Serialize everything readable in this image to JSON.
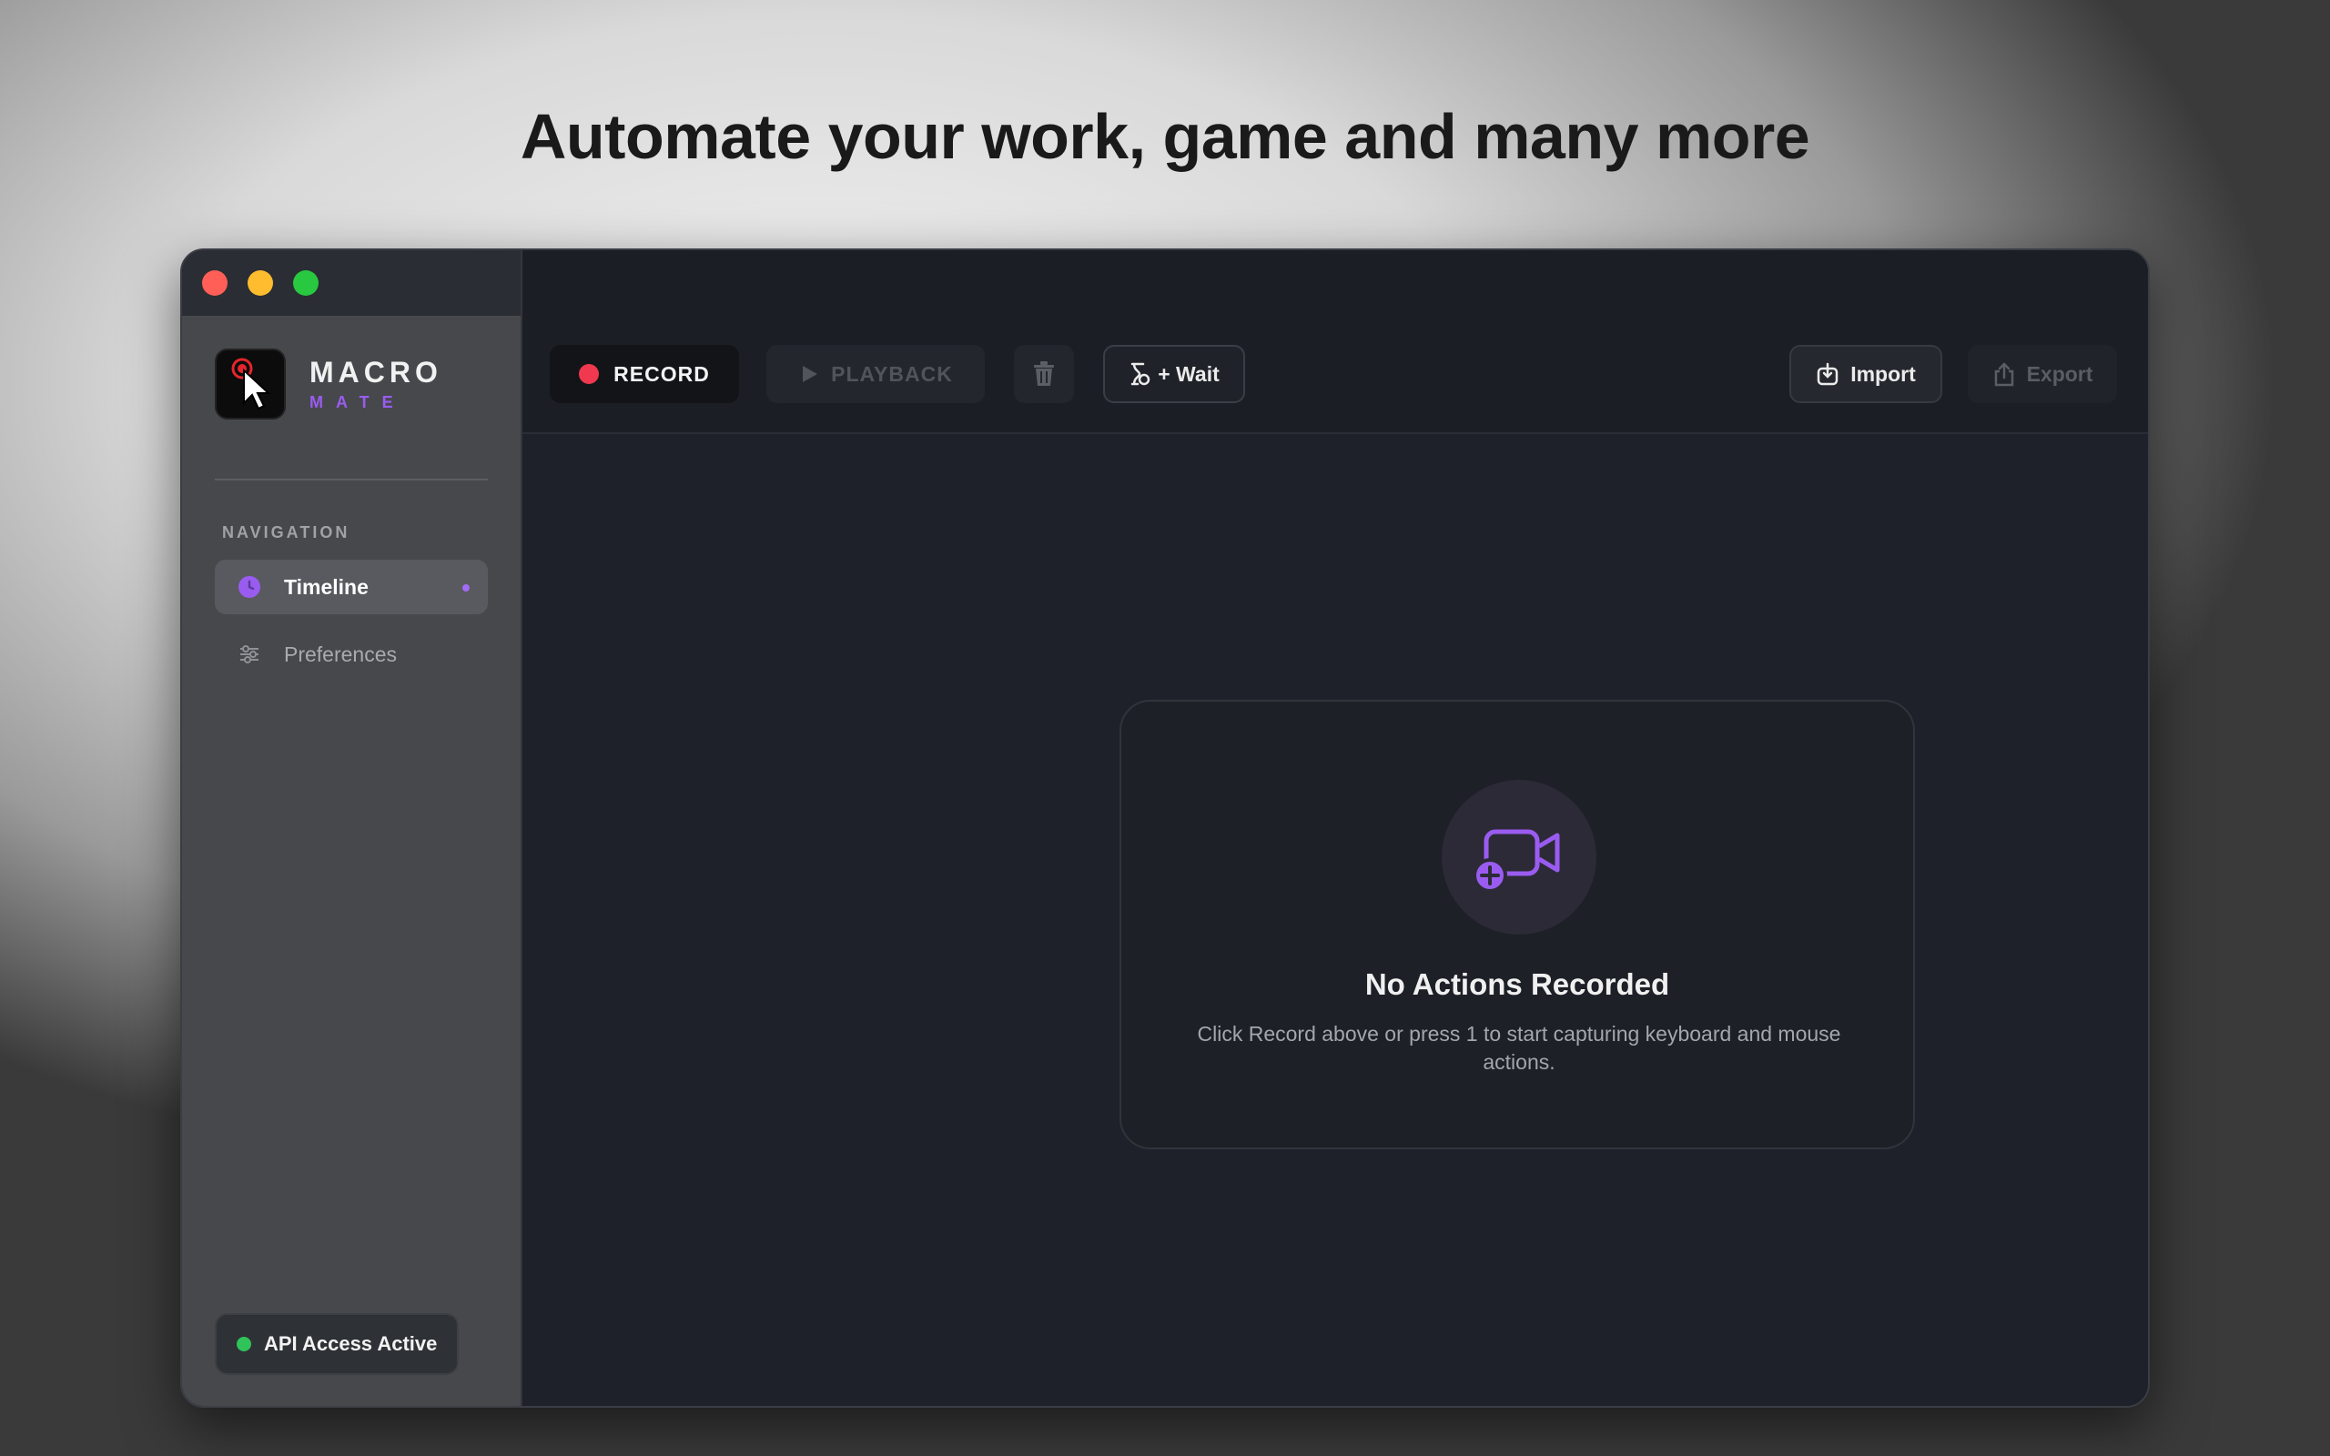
{
  "headline": "Automate your work, game and many more",
  "brand": {
    "title": "MACRO",
    "subtitle": "MATE"
  },
  "sidebar": {
    "heading": "NAVIGATION",
    "items": [
      {
        "label": "Timeline",
        "icon": "clock-icon",
        "active": true
      },
      {
        "label": "Preferences",
        "icon": "sliders-icon",
        "active": false
      }
    ],
    "api_status": "API Access Active"
  },
  "toolbar": {
    "record_label": "RECORD",
    "playback_label": "PLAYBACK",
    "wait_label": "+ Wait",
    "import_label": "Import",
    "export_label": "Export"
  },
  "empty_state": {
    "title": "No Actions Recorded",
    "description": "Click Record above or press 1 to start capturing keyboard and mouse actions."
  },
  "colors": {
    "accent": "#9a5cf0",
    "record": "#f0384f",
    "status_ok": "#2fc35a"
  }
}
